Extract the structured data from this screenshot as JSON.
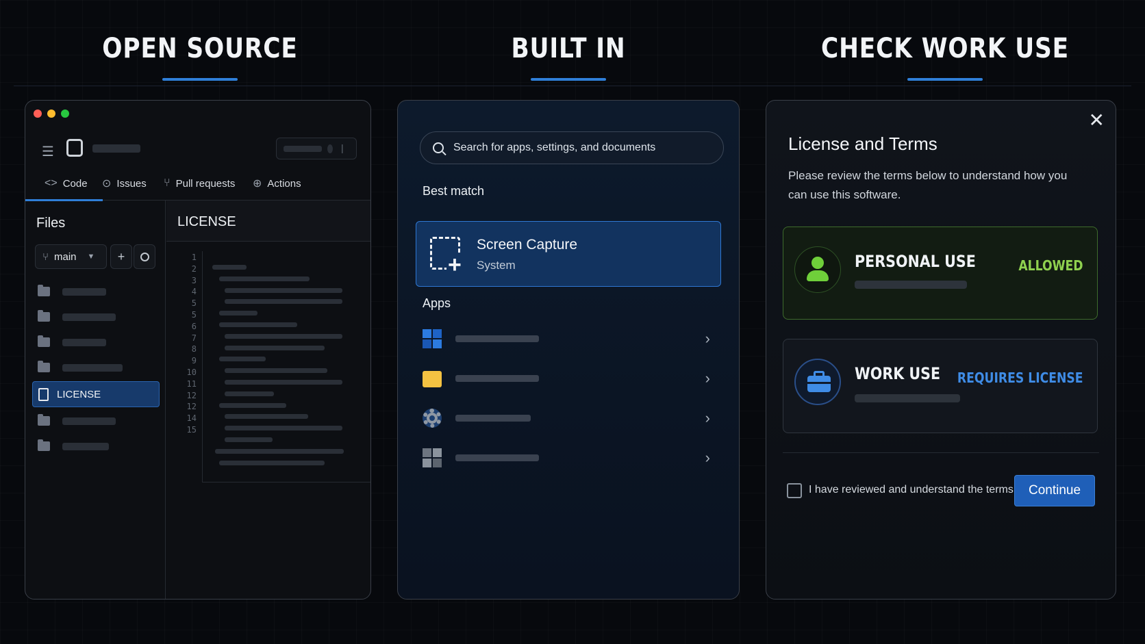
{
  "columns": {
    "open_source": "OPEN SOURCE",
    "built_in": "BUILT IN",
    "check_work_use": "CHECK WORK USE"
  },
  "repo": {
    "tabs": [
      {
        "label": "Code",
        "icon": "code-icon"
      },
      {
        "label": "Issues",
        "icon": "issues-icon"
      },
      {
        "label": "Pull requests",
        "icon": "pull-request-icon"
      },
      {
        "label": "Actions",
        "icon": "actions-icon"
      }
    ],
    "files_title": "Files",
    "branch": "main",
    "selected_file": "LICENSE",
    "file_header": "LICENSE",
    "line_numbers": [
      "1",
      "2",
      "3",
      "4",
      "5",
      "5",
      "6",
      "7",
      "8",
      "9",
      "10",
      "11",
      "12",
      "12",
      "14",
      "15"
    ]
  },
  "start_menu": {
    "search_placeholder": "Search for apps, settings, and documents",
    "best_match_label": "Best match",
    "best_match": {
      "title": "Screen Capture",
      "subtitle": "System"
    },
    "apps_label": "Apps"
  },
  "license_dialog": {
    "title": "License and Terms",
    "description": "Please review the terms below to understand how you can use this software.",
    "personal": {
      "title": "PERSONAL USE",
      "status": "ALLOWED",
      "status_color": "#8fd14f"
    },
    "work": {
      "title": "WORK USE",
      "status": "REQUIRES LICENSE",
      "status_color": "#3f8ce6"
    },
    "checkbox_label": "I have reviewed and understand the terms",
    "continue_label": "Continue"
  }
}
